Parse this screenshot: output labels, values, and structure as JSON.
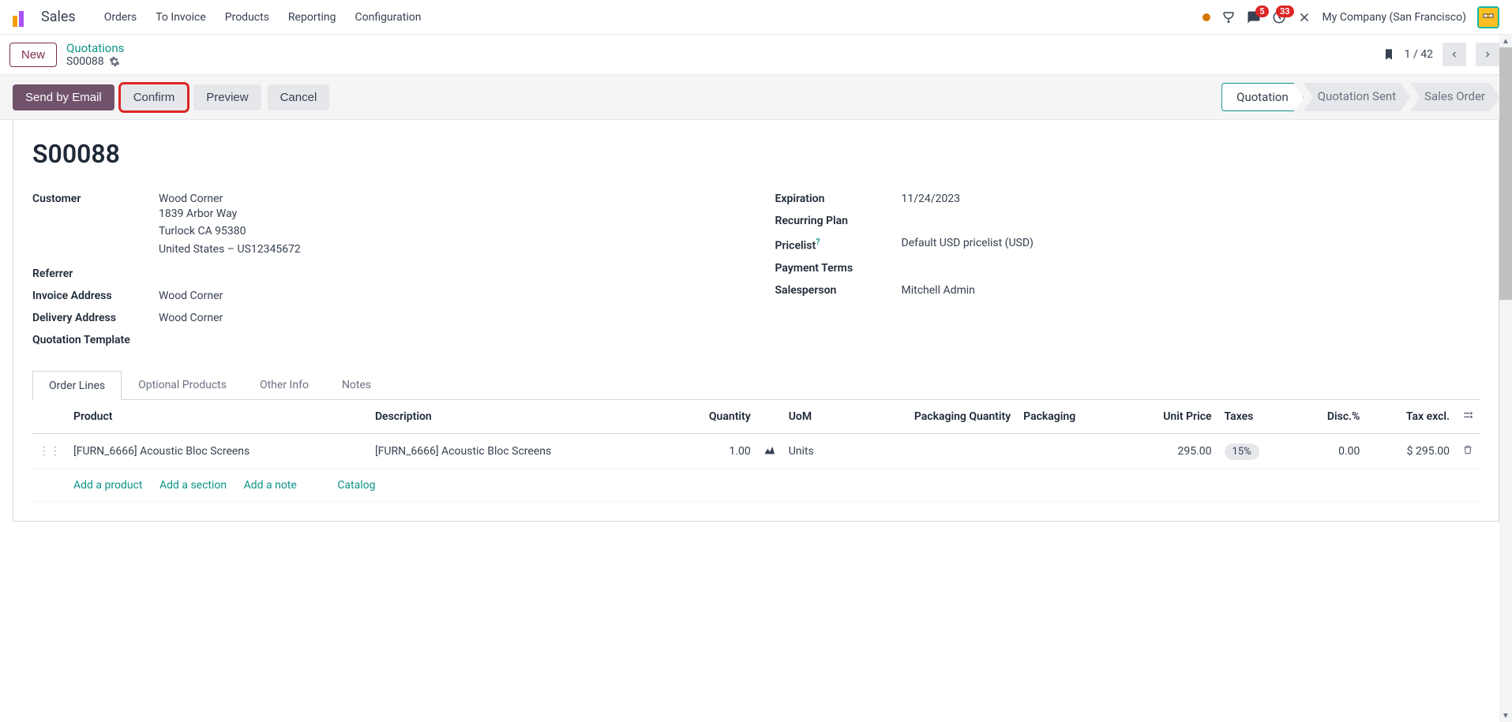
{
  "nav": {
    "app": "Sales",
    "items": [
      "Orders",
      "To Invoice",
      "Products",
      "Reporting",
      "Configuration"
    ],
    "company": "My Company (San Francisco)",
    "msg_badge": "5",
    "activity_badge": "33"
  },
  "control": {
    "new": "New",
    "breadcrumb_parent": "Quotations",
    "breadcrumb_current": "S00088",
    "pager": "1 / 42"
  },
  "actions": {
    "send": "Send by Email",
    "confirm": "Confirm",
    "preview": "Preview",
    "cancel": "Cancel"
  },
  "status": {
    "quotation": "Quotation",
    "sent": "Quotation Sent",
    "order": "Sales Order"
  },
  "record": {
    "title": "S00088",
    "left": {
      "customer_label": "Customer",
      "customer_name": "Wood Corner",
      "addr1": "1839 Arbor Way",
      "addr2": "Turlock CA 95380",
      "addr3": "United States – US12345672",
      "referrer_label": "Referrer",
      "invoice_label": "Invoice Address",
      "invoice_value": "Wood Corner",
      "delivery_label": "Delivery Address",
      "delivery_value": "Wood Corner",
      "template_label": "Quotation Template"
    },
    "right": {
      "expiration_label": "Expiration",
      "expiration_value": "11/24/2023",
      "recurring_label": "Recurring Plan",
      "pricelist_label": "Pricelist",
      "pricelist_value": "Default USD pricelist (USD)",
      "payment_label": "Payment Terms",
      "salesperson_label": "Salesperson",
      "salesperson_value": "Mitchell Admin"
    }
  },
  "tabs": [
    "Order Lines",
    "Optional Products",
    "Other Info",
    "Notes"
  ],
  "table": {
    "headers": {
      "product": "Product",
      "description": "Description",
      "quantity": "Quantity",
      "uom": "UoM",
      "pack_qty": "Packaging Quantity",
      "packaging": "Packaging",
      "unit_price": "Unit Price",
      "taxes": "Taxes",
      "disc": "Disc.%",
      "tax_excl": "Tax excl."
    },
    "rows": [
      {
        "product": "[FURN_6666] Acoustic Bloc Screens",
        "description": "[FURN_6666] Acoustic Bloc Screens",
        "quantity": "1.00",
        "uom": "Units",
        "unit_price": "295.00",
        "taxes": "15%",
        "disc": "0.00",
        "tax_excl": "$ 295.00"
      }
    ],
    "add_product": "Add a product",
    "add_section": "Add a section",
    "add_note": "Add a note",
    "catalog": "Catalog"
  }
}
